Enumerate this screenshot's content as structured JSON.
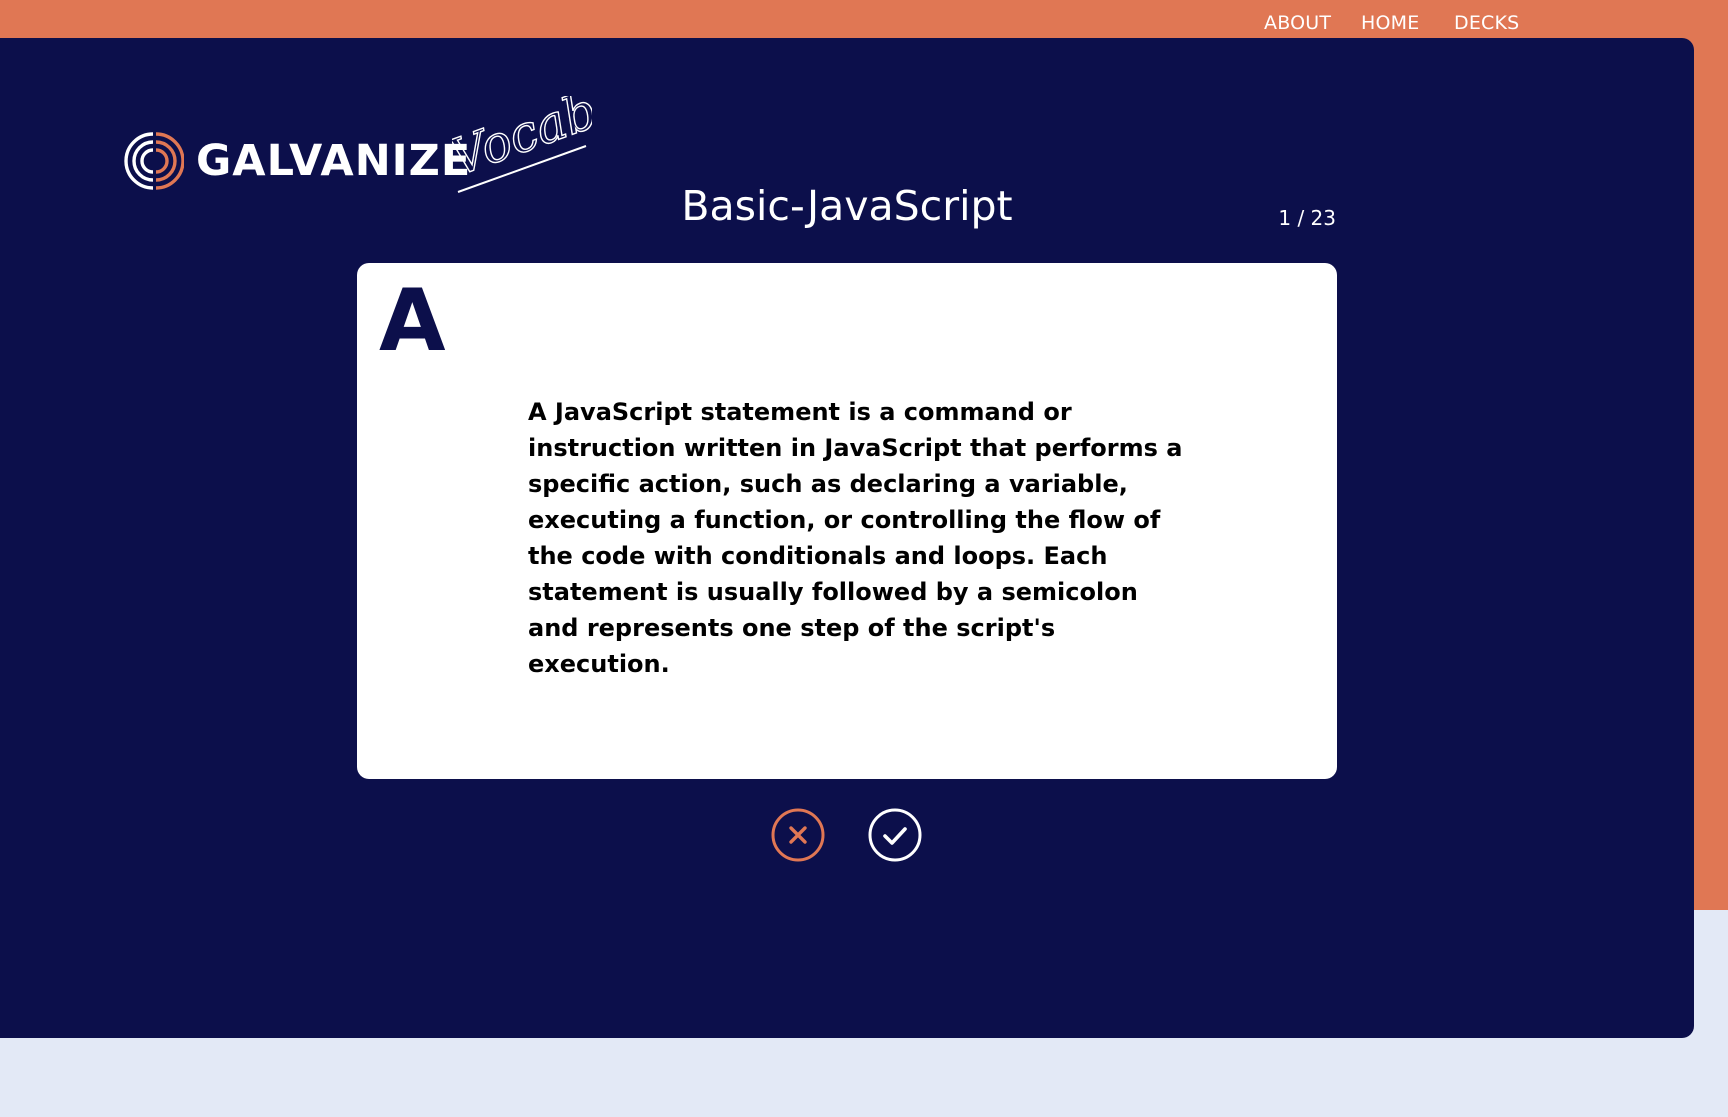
{
  "nav": {
    "about": "ABOUT",
    "home": "HOME",
    "decks": "DECKS"
  },
  "logo": {
    "word": "GALVANIZE",
    "script": "Vocab"
  },
  "deck": {
    "title": "Basic-JavaScript",
    "progress": "1 / 23"
  },
  "card": {
    "side": "A",
    "text": "A JavaScript statement is a command or instruction written in JavaScript that performs a specific action, such as declaring a variable, executing a function, or controlling the flow of the code with conditionals and loops. Each statement is usually followed by a semicolon and represents one step of the script's execution."
  },
  "actions": {
    "wrong_icon": "close-icon",
    "right_icon": "check-icon"
  },
  "colors": {
    "accent": "#e07754",
    "navy": "#0c0f4b",
    "page_bg": "#e3e9f6"
  }
}
